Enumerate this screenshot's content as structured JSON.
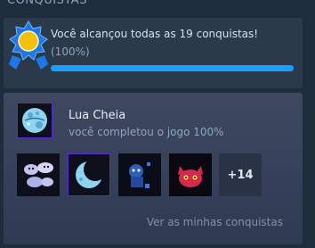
{
  "section": {
    "title": "CONQUISTAS"
  },
  "summary": {
    "text": "Você alcançou todas as 19 conquistas!",
    "percent_text": "(100%)",
    "progress_fraction": 1.0
  },
  "featured": {
    "name": "Lua Cheia",
    "description": "você completou o jogo 100%",
    "icon": "full-moon-icon"
  },
  "thumbnails": [
    {
      "icon": "ghost-cloud-icon"
    },
    {
      "icon": "crescent-moon-icon"
    },
    {
      "icon": "blue-creature-icon"
    },
    {
      "icon": "red-cat-icon"
    }
  ],
  "more_count": "+14",
  "link": {
    "label": "Ver as minhas conquistas"
  },
  "colors": {
    "accent": "#1a9fff",
    "badge_gold": "#f2c10f",
    "badge_blue": "#1f77e8"
  }
}
